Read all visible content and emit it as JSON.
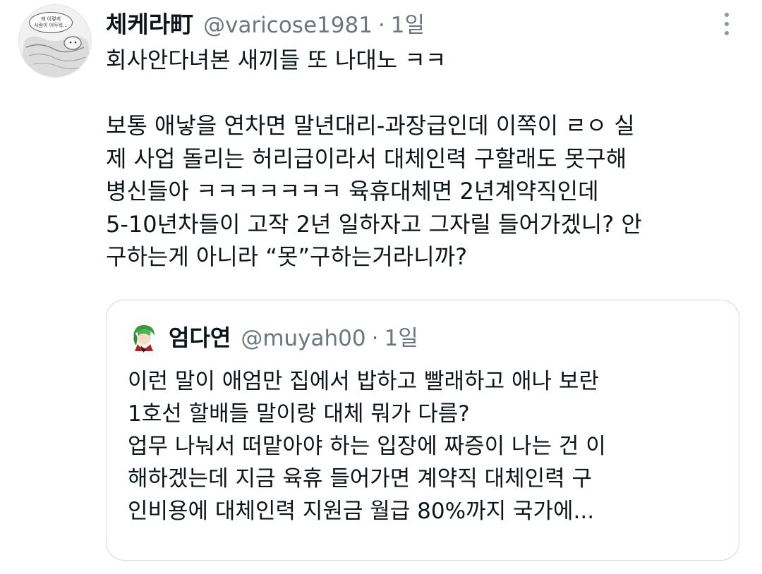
{
  "tweet": {
    "author": {
      "display_name": "체케라町",
      "handle": "@varicose1981",
      "separator": "·",
      "time": "1일",
      "avatar_caption": [
        "왜 이렇게",
        "사람이 어두워..."
      ]
    },
    "more_icon": "more-vertical-icon",
    "lines": [
      "회사안다녀본 새끼들 또 나대노 ㅋㅋ",
      "",
      "보통 애낳을 연차면 말년대리-과장급인데 이쪽이 ㄹㅇ 실",
      "제 사업 돌리는 허리급이라서 대체인력 구할래도 못구해",
      "병신들아 ㅋㅋㅋㅋㅋㅋㅋ 육휴대체면 2년계약직인데",
      "5-10년차들이 고작 2년 일하자고 그자릴 들어가겠니? 안",
      "구하는게 아니라 “못”구하는거라니까?"
    ]
  },
  "quote": {
    "author": {
      "display_name": "엄다연",
      "handle": "@muyah00",
      "separator": "·",
      "time": "1일"
    },
    "lines": [
      "이런 말이 애엄만 집에서 밥하고 빨래하고 애나 보란",
      "1호선 할배들 말이랑 대체 뭐가 다름?",
      "업무 나눠서 떠맡아야 하는 입장에 짜증이 나는 건 이",
      "해하겠는데 지금 육휴 들어가면 계약직 대체인력 구",
      "인비용에 대체인력 지원금 월급 80%까지 국가에..."
    ]
  },
  "colors": {
    "text": "#0f1419",
    "secondary": "#6e767d",
    "border": "#cfd9de",
    "background": "#ffffff"
  }
}
